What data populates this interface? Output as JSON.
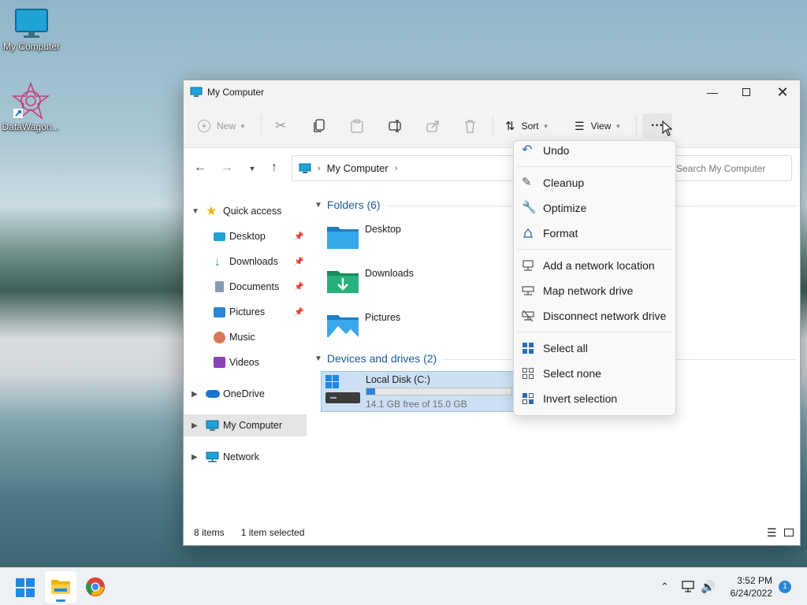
{
  "desktop": {
    "icons": [
      {
        "label": "My Computer"
      },
      {
        "label": "DataWagon..."
      }
    ]
  },
  "window": {
    "title": "My Computer",
    "toolbar": {
      "new_label": "New",
      "sort_label": "Sort",
      "view_label": "View",
      "more_label": "···"
    },
    "address": {
      "path": "My Computer",
      "search_placeholder": "Search My Computer"
    },
    "sidebar": {
      "quick_access": "Quick access",
      "items": [
        {
          "label": "Desktop",
          "pinned": true
        },
        {
          "label": "Downloads",
          "pinned": true
        },
        {
          "label": "Documents",
          "pinned": true
        },
        {
          "label": "Pictures",
          "pinned": true
        },
        {
          "label": "Music",
          "pinned": false
        },
        {
          "label": "Videos",
          "pinned": false
        }
      ],
      "onedrive": "OneDrive",
      "my_computer": "My Computer",
      "network": "Network"
    },
    "content": {
      "folders_header": "Folders (6)",
      "folders": [
        {
          "name": "Desktop"
        },
        {
          "name": "Downloads"
        },
        {
          "name": "Pictures"
        }
      ],
      "devices_header": "Devices and drives (2)",
      "drive": {
        "name": "Local Disk (C:)",
        "free_text": "14.1 GB free of 15.0 GB",
        "used_fraction": 0.06
      }
    },
    "status": {
      "items": "8 items",
      "selected": "1 item selected"
    }
  },
  "menu": {
    "items": [
      {
        "label": "Undo",
        "icon": "undo-icon"
      },
      {
        "label": "Cleanup",
        "icon": "brush-icon"
      },
      {
        "label": "Optimize",
        "icon": "wrench-icon"
      },
      {
        "label": "Format",
        "icon": "format-icon"
      },
      {
        "label": "Add a network location",
        "icon": "network-location-icon"
      },
      {
        "label": "Map network drive",
        "icon": "map-drive-icon"
      },
      {
        "label": "Disconnect network drive",
        "icon": "disconnect-drive-icon"
      },
      {
        "label": "Select all",
        "icon": "select-all-icon"
      },
      {
        "label": "Select none",
        "icon": "select-none-icon"
      },
      {
        "label": "Invert selection",
        "icon": "invert-selection-icon"
      }
    ]
  },
  "taskbar": {
    "time": "3:52 PM",
    "date": "6/24/2022",
    "notification_count": "1"
  },
  "colors": {
    "accent": "#2b86d6",
    "selection": "#cce0f4",
    "folder_header": "#1a5c9a"
  }
}
